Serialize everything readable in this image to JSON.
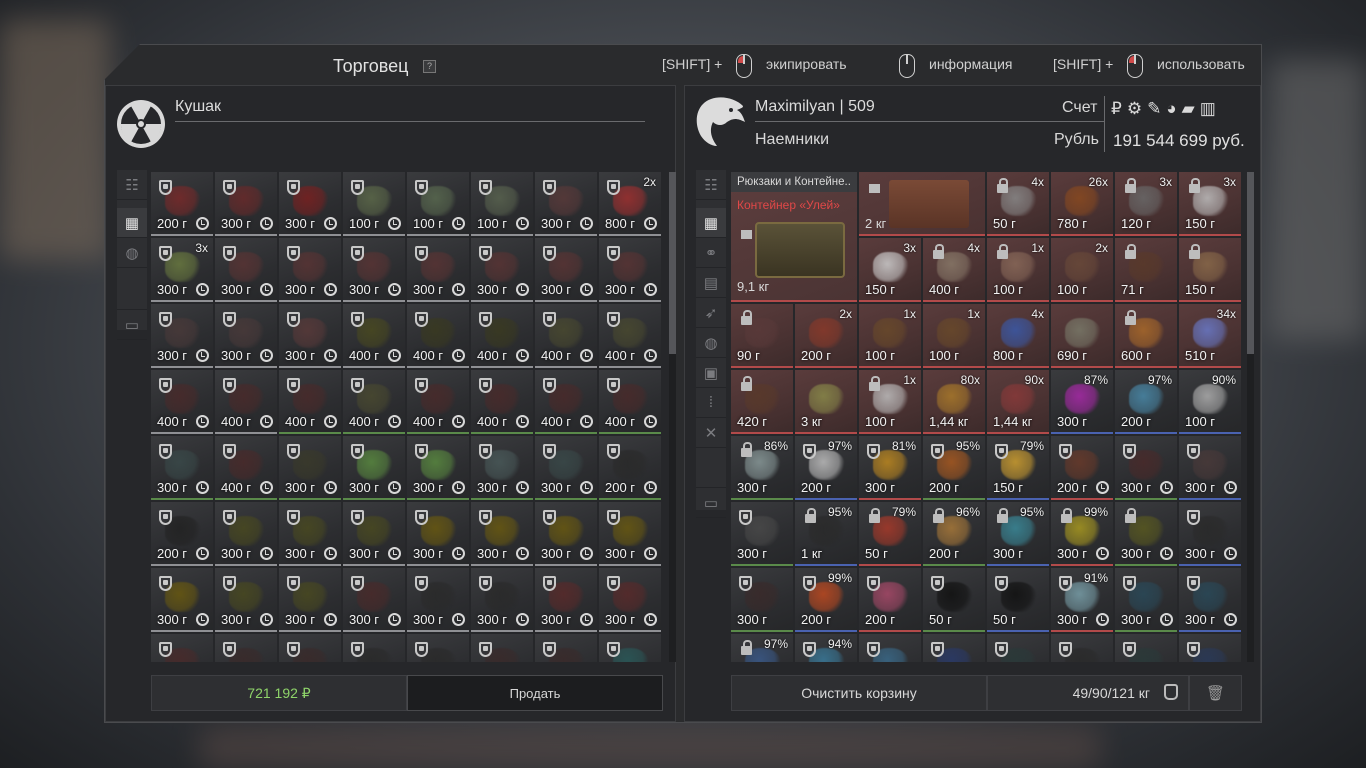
{
  "window": {
    "title": "Торговец",
    "help": "?",
    "hints": [
      {
        "prefix": "[SHIFT] +",
        "label": "экипировать"
      },
      {
        "prefix": "",
        "label": "информация"
      },
      {
        "prefix": "[SHIFT] +",
        "label": "использовать"
      }
    ]
  },
  "trader": {
    "name": "Кушак",
    "items": [
      {
        "w": "200 г",
        "c": "#7a2a2a"
      },
      {
        "w": "300 г",
        "c": "#6a2a2a"
      },
      {
        "w": "300 г",
        "c": "#7a2020"
      },
      {
        "w": "100 г",
        "c": "#5d6a4a"
      },
      {
        "w": "100 г",
        "c": "#5a6a50"
      },
      {
        "w": "100 г",
        "c": "#5a6450"
      },
      {
        "w": "300 г",
        "c": "#5a3a3a"
      },
      {
        "w": "800 г",
        "c": "#a03030",
        "n": "2x"
      },
      {
        "w": "300 г",
        "c": "#6a7a40",
        "n": "3x"
      },
      {
        "w": "300 г",
        "c": "#5a3434"
      },
      {
        "w": "300 г",
        "c": "#5a3434"
      },
      {
        "w": "300 г",
        "c": "#5a3434"
      },
      {
        "w": "300 г",
        "c": "#5a3434"
      },
      {
        "w": "300 г",
        "c": "#5a3434"
      },
      {
        "w": "300 г",
        "c": "#5a3434"
      },
      {
        "w": "300 г",
        "c": "#5a3434"
      },
      {
        "w": "300 г",
        "c": "#4a3a3a"
      },
      {
        "w": "300 г",
        "c": "#4a3a3a"
      },
      {
        "w": "300 г",
        "c": "#5a3a3a"
      },
      {
        "w": "400 г",
        "c": "#4a4a20"
      },
      {
        "w": "400 г",
        "c": "#3a3a20"
      },
      {
        "w": "400 г",
        "c": "#3a3a20"
      },
      {
        "w": "400 г",
        "c": "#4a4a30"
      },
      {
        "w": "400 г",
        "c": "#4a4a30"
      },
      {
        "w": "400 г",
        "c": "#4a2a2a"
      },
      {
        "w": "400 г",
        "c": "#4a2a2a"
      },
      {
        "w": "400 г",
        "c": "#4a2a2a"
      },
      {
        "w": "400 г",
        "c": "#4a4a30"
      },
      {
        "w": "400 г",
        "c": "#4a2a2a"
      },
      {
        "w": "400 г",
        "c": "#4a2a2a"
      },
      {
        "w": "400 г",
        "c": "#4a2a2a"
      },
      {
        "w": "400 г",
        "c": "#4a2a2a"
      },
      {
        "w": "300 г",
        "c": "#3a4a4a"
      },
      {
        "w": "400 г",
        "c": "#4a2a2a"
      },
      {
        "w": "300 г",
        "c": "#3a3a2a"
      },
      {
        "w": "300 г",
        "c": "#5a8a40"
      },
      {
        "w": "300 г",
        "c": "#5a8a40"
      },
      {
        "w": "300 г",
        "c": "#4a5a5a"
      },
      {
        "w": "300 г",
        "c": "#3a4a4a"
      },
      {
        "w": "200 г",
        "c": "#2a2a2a"
      },
      {
        "w": "200 г",
        "c": "#222222"
      },
      {
        "w": "300 г",
        "c": "#4a4a20"
      },
      {
        "w": "300 г",
        "c": "#4a4a20"
      },
      {
        "w": "300 г",
        "c": "#4a4a20"
      },
      {
        "w": "300 г",
        "c": "#6a5a10"
      },
      {
        "w": "300 г",
        "c": "#6a5a10"
      },
      {
        "w": "300 г",
        "c": "#6a5a10"
      },
      {
        "w": "300 г",
        "c": "#6a5a10"
      },
      {
        "w": "300 г",
        "c": "#6a5a10"
      },
      {
        "w": "300 г",
        "c": "#4a4a20"
      },
      {
        "w": "300 г",
        "c": "#4a4a20"
      },
      {
        "w": "300 г",
        "c": "#4a2a2a"
      },
      {
        "w": "300 г",
        "c": "#2a2a2a"
      },
      {
        "w": "300 г",
        "c": "#2a2a2a"
      },
      {
        "w": "300 г",
        "c": "#5a2a2a"
      },
      {
        "w": "300 г",
        "c": "#5a2a2a"
      },
      {
        "w": "",
        "c": "#4a2a2a"
      },
      {
        "w": "",
        "c": "#3a2a2a"
      },
      {
        "w": "",
        "c": "#3a2a2a"
      },
      {
        "w": "",
        "c": "#2a2a2a"
      },
      {
        "w": "",
        "c": "#2a2a2a"
      },
      {
        "w": "",
        "c": "#3a2a2a"
      },
      {
        "w": "",
        "c": "#3a2a2a"
      },
      {
        "w": "",
        "c": "#2a5a5a"
      }
    ],
    "total": "721 192",
    "currency_symbol": "₽",
    "sell_label": "Продать"
  },
  "player": {
    "name": "Maximilyan | 509",
    "faction": "Наемники",
    "account_label": "Счет",
    "currency_label": "Рубль",
    "balance": "191 544 699 руб.",
    "currency_icons": [
      "₽",
      "⚙",
      "✎",
      "◕",
      "▰",
      "▥"
    ],
    "container_category": "Рюкзаки и Контейне..",
    "container_name": "Контейнер «Улей»",
    "container_weight": "9,1 кг",
    "crate_weight": "2 кг",
    "items": [
      {
        "w": "50 г",
        "c": "#8a8a8a",
        "n": "4x",
        "lock": true
      },
      {
        "w": "780 г",
        "c": "#8a4a20",
        "n": "26x"
      },
      {
        "w": "120 г",
        "c": "#6a6a6a",
        "n": "3x",
        "lock": true
      },
      {
        "w": "150 г",
        "c": "#c0c0c0",
        "n": "3x",
        "lock": true
      },
      {
        "w": "150 г",
        "c": "#d0d0d0",
        "n": "3x"
      },
      {
        "w": "400 г",
        "c": "#8a7a6a",
        "n": "4x",
        "lock": true
      },
      {
        "w": "100 г",
        "c": "#8a6a5a",
        "n": "1x",
        "lock": true
      },
      {
        "w": "100 г",
        "c": "#6a4a3a",
        "n": "2x"
      },
      {
        "w": "71 г",
        "c": "#5a3a2a",
        "lock": true
      },
      {
        "w": "150 г",
        "c": "#8a6a4a",
        "lock": true
      },
      {
        "w": "90 г",
        "c": "#5a3a3a",
        "lock": true
      },
      {
        "w": "200 г",
        "c": "#8a3a2a",
        "n": "2x"
      },
      {
        "w": "100 г",
        "c": "#6a4a2a",
        "n": "1x"
      },
      {
        "w": "100 г",
        "c": "#6a4a2a",
        "n": "1x"
      },
      {
        "w": "800 г",
        "c": "#3a5aaa",
        "n": "4x"
      },
      {
        "w": "690 г",
        "c": "#7a7a6a"
      },
      {
        "w": "600 г",
        "c": "#aa6a2a",
        "lock": true
      },
      {
        "w": "510 г",
        "c": "#6a7aca",
        "n": "34x"
      },
      {
        "w": "420 г",
        "c": "#5a3a2a",
        "lock": true
      },
      {
        "w": "3 кг",
        "c": "#8a8a4a"
      },
      {
        "w": "100 г",
        "c": "#c0c0c0",
        "n": "1x",
        "lock": true
      },
      {
        "w": "1,44 кг",
        "c": "#aa7a2a",
        "n": "80x"
      },
      {
        "w": "1,44 кг",
        "c": "#8a3a3a",
        "n": "90x"
      },
      {
        "w": "300 г",
        "c": "#aa2aaa",
        "n": "87%"
      },
      {
        "w": "200 г",
        "c": "#4a8aaa",
        "n": "97%"
      },
      {
        "w": "100 г",
        "c": "#b0b0b0",
        "n": "90%"
      },
      {
        "w": "300 г",
        "c": "#8a9a9a",
        "n": "86%",
        "lock": true
      },
      {
        "w": "200 г",
        "c": "#c0c0c0",
        "n": "97%"
      },
      {
        "w": "300 г",
        "c": "#c08a20",
        "n": "81%"
      },
      {
        "w": "200 г",
        "c": "#aa5a20",
        "n": "95%"
      },
      {
        "w": "150 г",
        "c": "#d0a030",
        "n": "79%"
      },
      {
        "w": "200 г",
        "c": "#6a3a2a"
      },
      {
        "w": "300 г",
        "c": "#4a2a2a"
      },
      {
        "w": "300 г",
        "c": "#4a3a3a"
      },
      {
        "w": "300 г",
        "c": "#4a4a4a"
      },
      {
        "w": "1 кг",
        "c": "#2a2a2a",
        "n": "95%",
        "lock": true
      },
      {
        "w": "50 г",
        "c": "#aa3a2a",
        "n": "79%",
        "lock": true
      },
      {
        "w": "200 г",
        "c": "#aa7a3a",
        "n": "96%",
        "lock": true
      },
      {
        "w": "300 г",
        "c": "#3a8a9a",
        "n": "95%",
        "lock": true
      },
      {
        "w": "300 г",
        "c": "#aa9a20",
        "n": "99%",
        "lock": true
      },
      {
        "w": "300 г",
        "c": "#5a5a20",
        "lock": true
      },
      {
        "w": "300 г",
        "c": "#2a2a2a"
      },
      {
        "w": "300 г",
        "c": "#3a2a2a"
      },
      {
        "w": "200 г",
        "c": "#c04a20",
        "n": "99%"
      },
      {
        "w": "200 г",
        "c": "#aa4a6a"
      },
      {
        "w": "50 г",
        "c": "#111111"
      },
      {
        "w": "50 г",
        "c": "#111111"
      },
      {
        "w": "300 г",
        "c": "#7aa0aa",
        "n": "91%"
      },
      {
        "w": "300 г",
        "c": "#2a4a5a"
      },
      {
        "w": "300 г",
        "c": "#2a4a5a"
      },
      {
        "w": "",
        "c": "#3a5a8a",
        "n": "97%",
        "lock": true
      },
      {
        "w": "",
        "c": "#3a7a9a",
        "n": "94%"
      },
      {
        "w": "",
        "c": "#3a6a8a"
      },
      {
        "w": "",
        "c": "#2a3a6a"
      },
      {
        "w": "",
        "c": "#2a3a3a"
      },
      {
        "w": "",
        "c": "#2a2a2a"
      },
      {
        "w": "",
        "c": "#2a3a3a"
      },
      {
        "w": "",
        "c": "#2a3a5a"
      }
    ],
    "clear_label": "Очистить корзину",
    "weight_total": "49/90/121 кг"
  }
}
